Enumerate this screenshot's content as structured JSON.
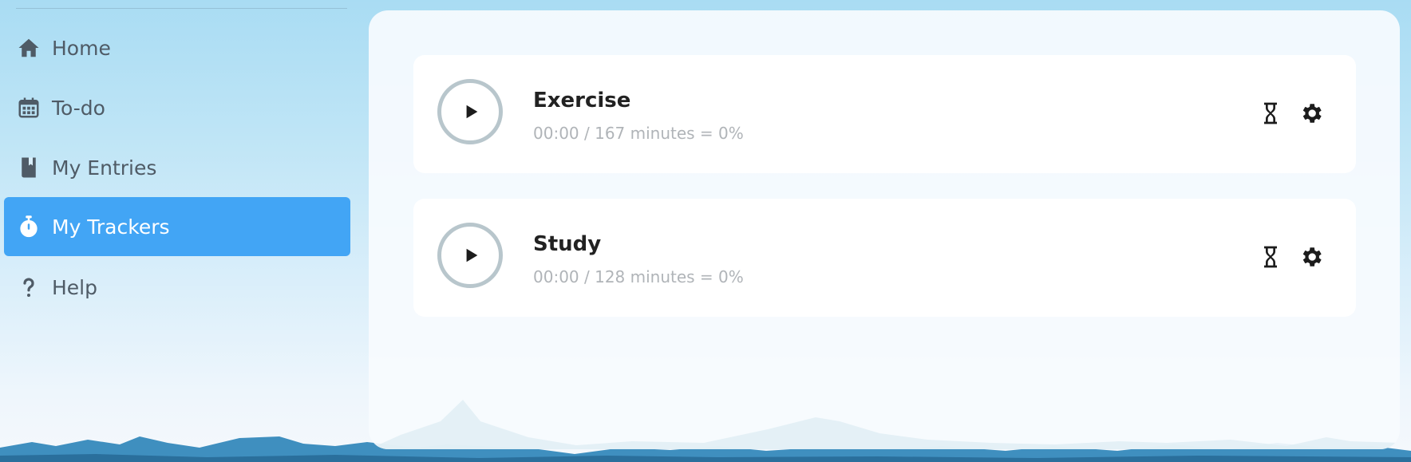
{
  "sidebar": {
    "items": [
      {
        "label": "Home",
        "icon": "home-icon",
        "active": false
      },
      {
        "label": "To-do",
        "icon": "calendar-icon",
        "active": false
      },
      {
        "label": "My Entries",
        "icon": "book-icon",
        "active": false
      },
      {
        "label": "My Trackers",
        "icon": "stopwatch-icon",
        "active": true
      },
      {
        "label": "Help",
        "icon": "question-icon",
        "active": false
      }
    ]
  },
  "trackers": [
    {
      "name": "Exercise",
      "progress": "00:00 / 167 minutes = 0%"
    },
    {
      "name": "Study",
      "progress": "00:00 / 128 minutes = 0%"
    }
  ],
  "colors": {
    "accent": "#42a5f5",
    "nav_text": "#4f5b66",
    "progress_text": "#b0b4b8",
    "play_ring": "#b8c6cc"
  }
}
